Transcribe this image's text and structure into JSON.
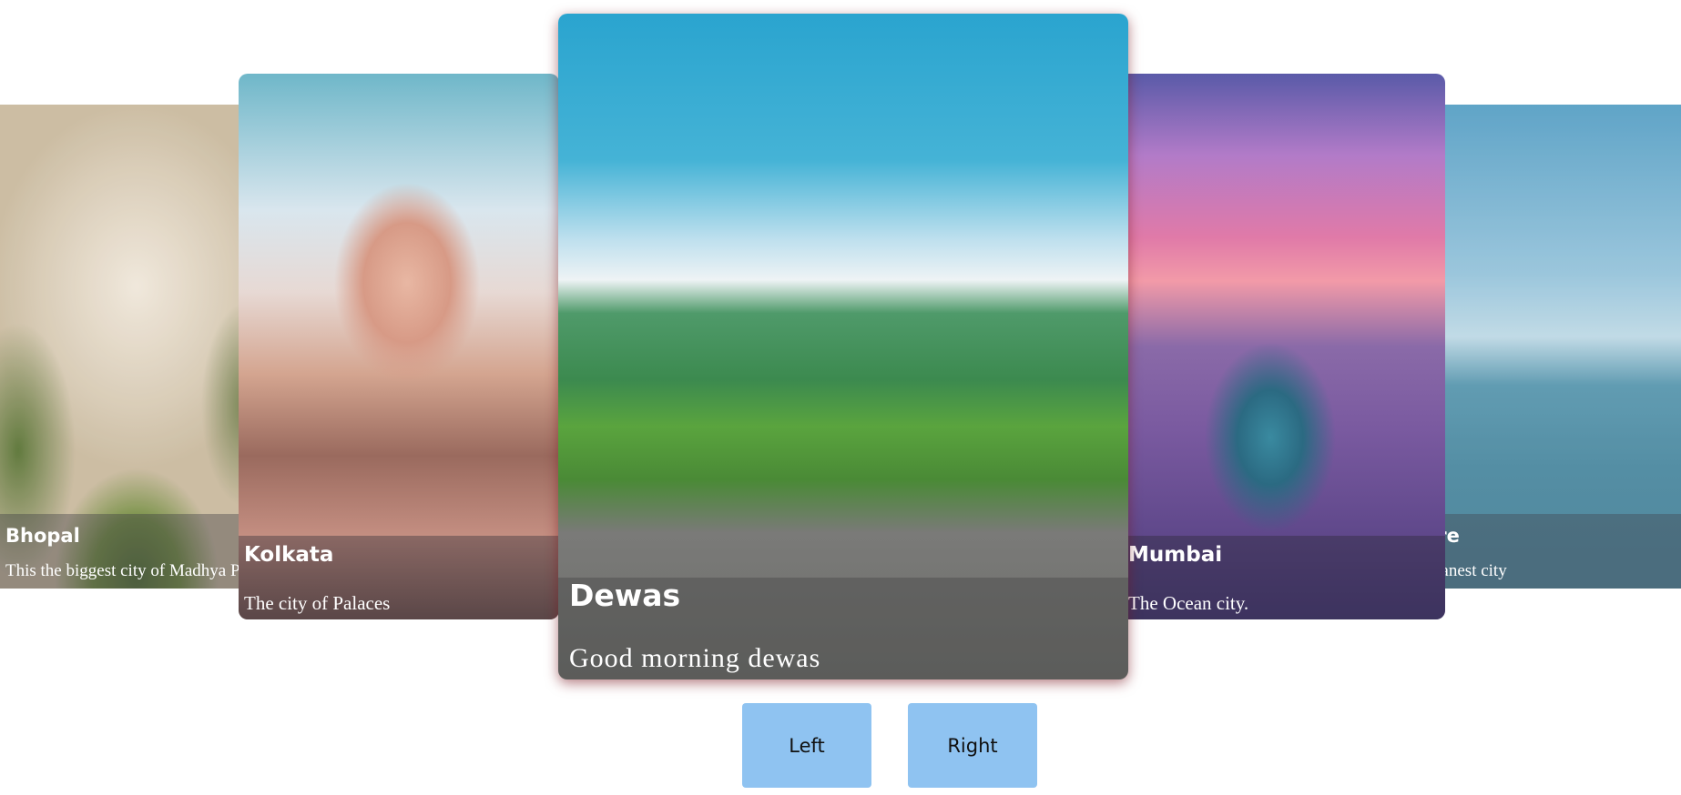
{
  "carousel": {
    "cards": [
      {
        "id": "bhopal",
        "title": "Bhopal",
        "description": "This the biggest city of Madhya Pradesh"
      },
      {
        "id": "kolkata",
        "title": "Kolkata",
        "description": "The city of Palaces"
      },
      {
        "id": "dewas",
        "title": "Dewas",
        "description": "Good morning dewas",
        "active": true
      },
      {
        "id": "mumbai",
        "title": "Mumbai",
        "description": "The Ocean city."
      },
      {
        "id": "indore",
        "title": "Indore",
        "description": "The cleanest city"
      }
    ]
  },
  "controls": {
    "left_label": "Left",
    "right_label": "Right"
  },
  "colors": {
    "button_bg": "#8fc3f1",
    "active_shadow": "#78141e"
  }
}
